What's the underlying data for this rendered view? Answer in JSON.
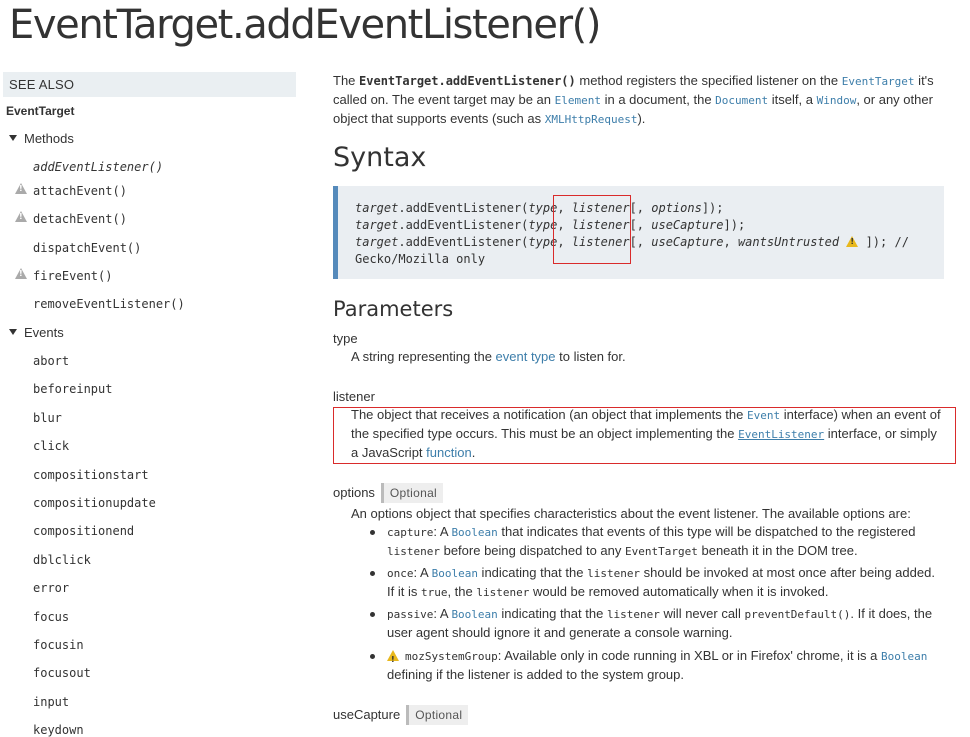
{
  "page": {
    "title": "EventTarget.addEventListener()"
  },
  "sidebar": {
    "see_also": "SEE ALSO",
    "interface": "EventTarget",
    "methods_label": "Methods",
    "methods": [
      {
        "label": "addEventListener()",
        "current": true,
        "warning": false
      },
      {
        "label": "attachEvent()",
        "current": false,
        "warning": true
      },
      {
        "label": "detachEvent()",
        "current": false,
        "warning": true
      },
      {
        "label": "dispatchEvent()",
        "current": false,
        "warning": false
      },
      {
        "label": "fireEvent()",
        "current": false,
        "warning": true
      },
      {
        "label": "removeEventListener()",
        "current": false,
        "warning": false
      }
    ],
    "events_label": "Events",
    "events": [
      "abort",
      "beforeinput",
      "blur",
      "click",
      "compositionstart",
      "compositionupdate",
      "compositionend",
      "dblclick",
      "error",
      "focus",
      "focusin",
      "focusout",
      "input",
      "keydown"
    ]
  },
  "intro": {
    "p1": "The ",
    "method": "EventTarget.addEventListener()",
    "p2": " method registers the specified listener on the ",
    "link_eventtarget": "EventTarget",
    "p3": " it's called on. The event target may be an ",
    "link_element": "Element",
    "p4": " in a document, the ",
    "link_document": "Document",
    "p5": " itself, a ",
    "link_window": "Window",
    "p6": ", or any other object that supports events (such as ",
    "link_xhr": "XMLHttpRequest",
    "p7": ")."
  },
  "syntax": {
    "heading": "Syntax",
    "line1": {
      "target": "target",
      "method": ".addEventListener(",
      "type": "type",
      "sep": ", ",
      "listener": "listener",
      "bracket": "[, ",
      "opt": "options",
      "end": "]);"
    },
    "line2": {
      "target": "target",
      "method": ".addEventListener(",
      "type": "type",
      "sep": ", ",
      "listener": "listener",
      "bracket": "[, ",
      "opt": "useCapture",
      "end": "]);"
    },
    "line3": {
      "target": "target",
      "method": ".addEventListener(",
      "type": "type",
      "sep": ", ",
      "listener": "listener",
      "bracket": "[, ",
      "opt": "useCapture",
      "sep2": ", ",
      "opt2": "wantsUntrusted",
      "end": " ]); //"
    },
    "line4": "Gecko/Mozilla only"
  },
  "parameters": {
    "heading": "Parameters",
    "type": {
      "term": "type",
      "d1": "A string representing the ",
      "link": "event type",
      "d2": " to listen for."
    },
    "listener": {
      "term": "listener",
      "d1": "The object that receives a notification (an object that implements the ",
      "link_event": "Event",
      "d2": " interface) when an event of the specified type occurs. This must be an object implementing the ",
      "link_eventlistener": "EventListener",
      "d3": " interface, or simply a JavaScript ",
      "link_function": "function",
      "d4": "."
    },
    "options": {
      "term": "options",
      "badge": "Optional",
      "desc": "An options object that specifies characteristics about the event listener. The available options are:",
      "capture": {
        "name": "capture",
        "t1": ": A ",
        "link": "Boolean",
        "t2": " that indicates that events of this type will be dispatched to the registered ",
        "code1": "listener",
        "t3": " before being dispatched to any ",
        "code2": "EventTarget",
        "t4": " beneath it in the DOM tree."
      },
      "once": {
        "name": "once",
        "t1": ": A ",
        "link": "Boolean",
        "t2": " indicating that the ",
        "code1": "listener",
        "t3": " should be invoked at most once after being added. If it is ",
        "code2": "true",
        "t4": ", the ",
        "code3": "listener",
        "t5": " would be removed automatically when it is invoked."
      },
      "passive": {
        "name": "passive",
        "t1": ": A ",
        "link": "Boolean",
        "t2": " indicating that the ",
        "code1": "listener",
        "t3": " will never call ",
        "code2": "preventDefault()",
        "t4": ". If it does, the user agent should ignore it and generate a console warning."
      },
      "moz": {
        "name": "mozSystemGroup",
        "t1": ": Available only in code running in XBL or in Firefox' chrome, it is a ",
        "link": "Boolean",
        "t2": " defining if the listener is added to the system group."
      }
    },
    "useCapture": {
      "term": "useCapture",
      "badge": "Optional"
    }
  },
  "colors": {
    "link": "#3d7eaa",
    "highlight_border": "#d92b2b",
    "code_bg": "#eaeef2",
    "code_border": "#558abb",
    "warning": "#e8b81d"
  }
}
